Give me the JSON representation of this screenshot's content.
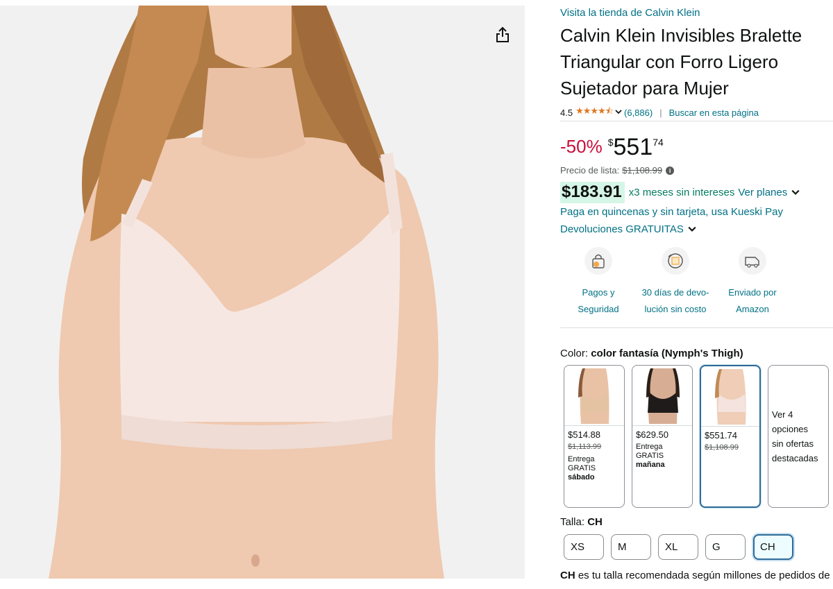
{
  "image": {
    "alt_icon": "share-icon"
  },
  "product": {
    "store_link": "Visita la tienda de Calvin Klein",
    "title": "Calvin Klein Invisibles Bralette Triangular con Forro Ligero Sujetador para Mujer",
    "rating": "4.5",
    "stars": "★★★★⯪",
    "review_count": "(6,886)",
    "separator": "|",
    "search_page": "Buscar en esta página"
  },
  "price": {
    "discount": "-50%",
    "currency": "$",
    "whole": "551",
    "cents": "74",
    "list_label": "Precio de lista:",
    "list_value": "$1,108.99",
    "installment_price": "$183.91",
    "installment_text": "x3 meses sin intereses",
    "plans_link": "Ver planes",
    "kueski": "Paga en quincenas y sin tarjeta, usa Kueski Pay",
    "returns": "Devoluciones GRATUITAS"
  },
  "features": [
    {
      "icon": "secure-payment-icon",
      "label": "Pagos y\nSeguridad"
    },
    {
      "icon": "return-icon",
      "label": "30 días de devo-\nlución sin costo"
    },
    {
      "icon": "delivery-van-icon",
      "label": "Enviado por\nAmazon"
    }
  ],
  "color": {
    "label": "Color:",
    "value": "color fantasía (Nymph's Thigh)",
    "options": [
      {
        "price": "$514.88",
        "list": "$1,113.99",
        "delivery1": "Entrega",
        "delivery2": "GRATIS",
        "delivery3": "sábado",
        "tone": "#e4c3a3"
      },
      {
        "price": "$629.50",
        "list": "",
        "delivery1": "Entrega",
        "delivery2": "GRATIS",
        "delivery3": "mañana",
        "tone": "#1f1b1b"
      },
      {
        "price": "$551.74",
        "list": "$1,108.99",
        "delivery1": "",
        "delivery2": "",
        "delivery3": "",
        "tone": "#f2dfd9"
      }
    ],
    "more": "Ver 4\nopciones\nsin ofertas\ndestacadas"
  },
  "size": {
    "label": "Talla:",
    "value": "CH",
    "options": [
      "XS",
      "M",
      "XL",
      "G",
      "CH"
    ],
    "reco_bold": "CH",
    "reco_text": " es tu talla recomendada según millones de pedidos de clientes"
  }
}
